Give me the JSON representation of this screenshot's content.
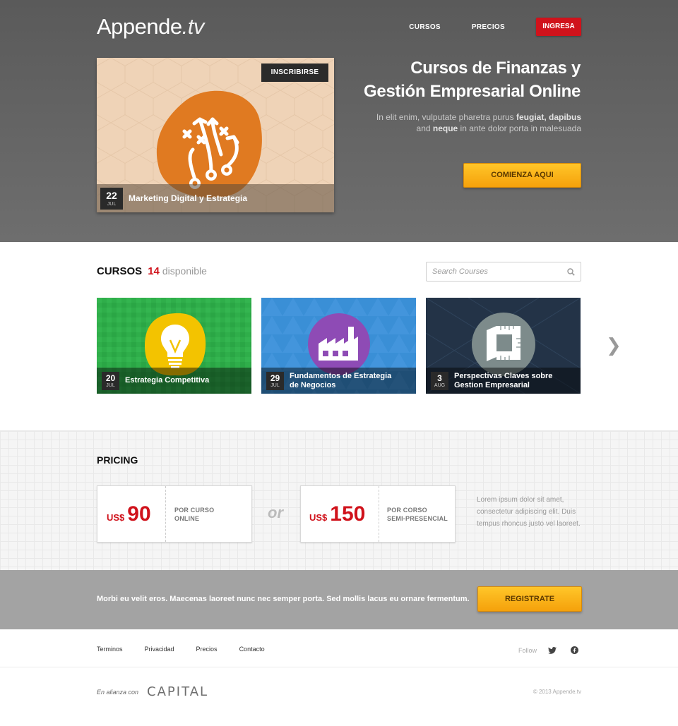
{
  "header": {
    "logo_main": "Appende",
    "logo_suffix": ".tv",
    "nav": {
      "courses": "CURSOS",
      "pricing": "PRECIOS",
      "login": "INGRESA"
    }
  },
  "hero": {
    "heading_line1": "Cursos de Finanzas y",
    "heading_line2": "Gestión Empresarial Online",
    "sub_a": "In elit enim, vulputate pharetra purus ",
    "sub_b": "feugiat, dapibus",
    "sub_c": "and ",
    "sub_d": "neque",
    "sub_e": " in ante dolor porta in malesuada",
    "cta": "COMIENZA AQUI",
    "featured": {
      "enroll": "INSCRIBIRSE",
      "day": "22",
      "month": "JUL",
      "title": "Marketing Digital y Estrategia",
      "icon": "strategy-playbook-icon",
      "colors": {
        "background": "#efd3b7",
        "badge": "#e07a21"
      }
    }
  },
  "courses": {
    "label": "CURSOS",
    "count": "14",
    "available": "disponible",
    "search_placeholder": "Search Courses",
    "items": [
      {
        "day": "20",
        "month": "JUL",
        "title": "Estrategia Competitiva",
        "icon": "lightbulb-icon",
        "bg": "#2fae4a",
        "badge": "#f3c300"
      },
      {
        "day": "29",
        "month": "JUL",
        "title_line1": "Fundamentos de Estrategia",
        "title_line2": "de Negocios",
        "icon": "factory-icon",
        "bg": "#3a8fd6",
        "badge": "#8e4bb5"
      },
      {
        "day": "3",
        "month": "AUG",
        "title_line1": "Perspectivas Claves sobre",
        "title_line2": "Gestion Empresarial",
        "icon": "blueprint-icon",
        "bg": "#233347",
        "badge": "#7d8b8b"
      }
    ]
  },
  "pricing": {
    "title": "PRICING",
    "plans": [
      {
        "currency": "US$",
        "amount": "90",
        "desc_line1": "POR CURSO",
        "desc_line2": "ONLINE"
      },
      {
        "currency": "US$",
        "amount": "150",
        "desc_line1": "POR CORSO",
        "desc_line2": "SEMI-PRESENCIAL"
      }
    ],
    "or": "or",
    "note": "Lorem ipsum dolor sit amet, consectetur adipiscing elit. Duis tempus rhoncus justo vel laoreet."
  },
  "band": {
    "text": "Morbi eu velit eros. Maecenas laoreet nunc nec semper porta. Sed mollis lacus eu ornare fermentum.",
    "button": "REGISTRATE"
  },
  "footer": {
    "links": [
      "Terminos",
      "Privacidad",
      "Precios",
      "Contacto"
    ],
    "follow": "Follow",
    "partner_label": "En alianza con",
    "partner_name": "CAPITAL",
    "copyright": "© 2013 Appende.tv"
  },
  "colors": {
    "accent_red": "#d0121b",
    "accent_orange": "#f5a10b"
  }
}
